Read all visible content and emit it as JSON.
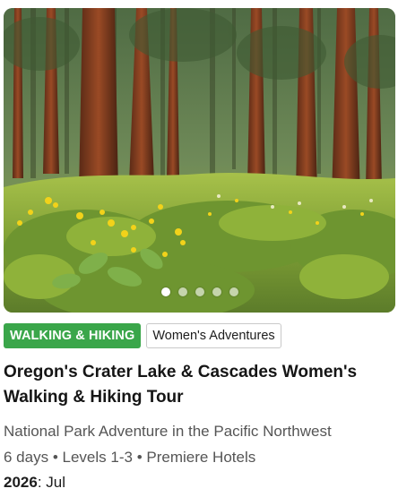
{
  "card": {
    "image_alt": "Ponderosa pine forest with yellow wildflowers",
    "carousel": {
      "count": 5,
      "active_index": 0
    },
    "tags": [
      {
        "label": "WALKING & HIKING",
        "color": "#3aa64a"
      },
      {
        "label": "Women's Adventures"
      }
    ],
    "title": "Oregon's Crater Lake & Cascades Women's Walking & Hiking Tour",
    "subtitle": "National Park Adventure in the Pacific Northwest",
    "meta": {
      "duration": "6 days",
      "levels": "Levels 1-3",
      "hotels": "Premiere Hotels",
      "separator": "•"
    },
    "dates": {
      "year": "2026",
      "months": "Jul"
    }
  }
}
